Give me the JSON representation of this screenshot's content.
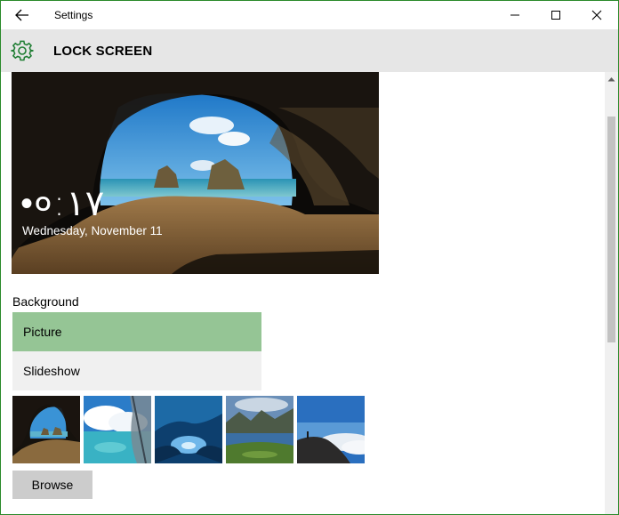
{
  "window": {
    "title": "Settings",
    "back_icon": "back-arrow-icon",
    "minimize_icon": "minimize-icon",
    "maximize_icon": "maximize-icon",
    "close_icon": "close-icon"
  },
  "header": {
    "icon": "gear-icon",
    "title": "LOCK SCREEN",
    "accent_color": "#1e7d32"
  },
  "preview": {
    "time": "•०:١٧",
    "date": "Wednesday, November 11"
  },
  "background": {
    "label": "Background",
    "options": [
      {
        "label": "Picture",
        "selected": true
      },
      {
        "label": "Slideshow",
        "selected": false
      }
    ],
    "selected_color": "#95c595"
  },
  "thumbnails": [
    {
      "name": "cave-beach"
    },
    {
      "name": "sky-window"
    },
    {
      "name": "ice-cave"
    },
    {
      "name": "mountain-lake"
    },
    {
      "name": "cliff-clouds"
    }
  ],
  "browse_label": "Browse"
}
